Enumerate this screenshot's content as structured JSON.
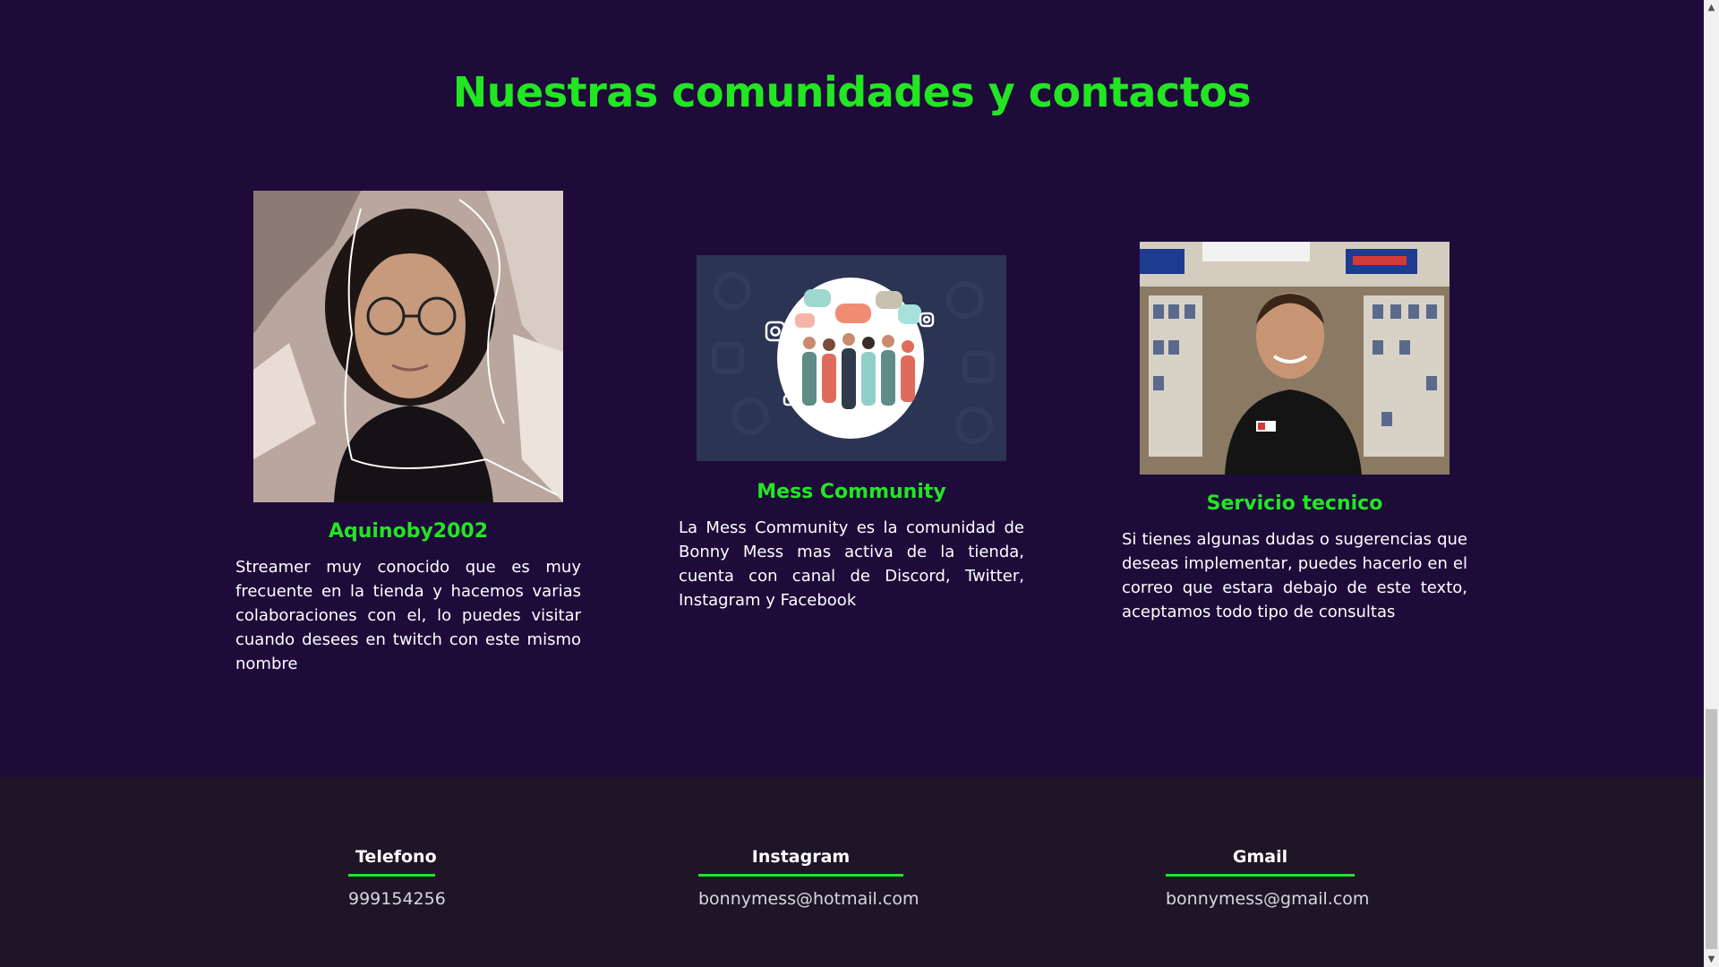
{
  "section": {
    "title": "Nuestras comunidades y contactos"
  },
  "cards": [
    {
      "image_alt": "streamer-photo",
      "title": "Aquinoby2002",
      "text": "Streamer muy conocido que es muy frecuente en la tienda y hacemos varias colaboraciones con el, lo puedes visitar cuando desees en twitch con este mismo nombre"
    },
    {
      "image_alt": "community-illustration",
      "title": "Mess Community",
      "text": "La Mess Community es la comunidad de Bonny Mess mas activa de la tienda, cuenta con canal de Discord, Twitter, Instagram y Facebook"
    },
    {
      "image_alt": "tech-service-photo",
      "title": "Servicio tecnico",
      "text": "Si tienes algunas dudas o sugerencias que deseas implementar, puedes hacerlo en el correo que estara debajo de este texto, aceptamos todo tipo de consultas"
    }
  ],
  "footer": {
    "phone_label": "Telefono",
    "phone_value": "999154256",
    "instagram_label": "Instagram",
    "instagram_value": "bonnymess@hotmail.com",
    "gmail_label": "Gmail",
    "gmail_value": "bonnymess@gmail.com"
  },
  "colors": {
    "background": "#1e0b3a",
    "accent": "#22e622",
    "footer_bg": "#1e1526"
  }
}
